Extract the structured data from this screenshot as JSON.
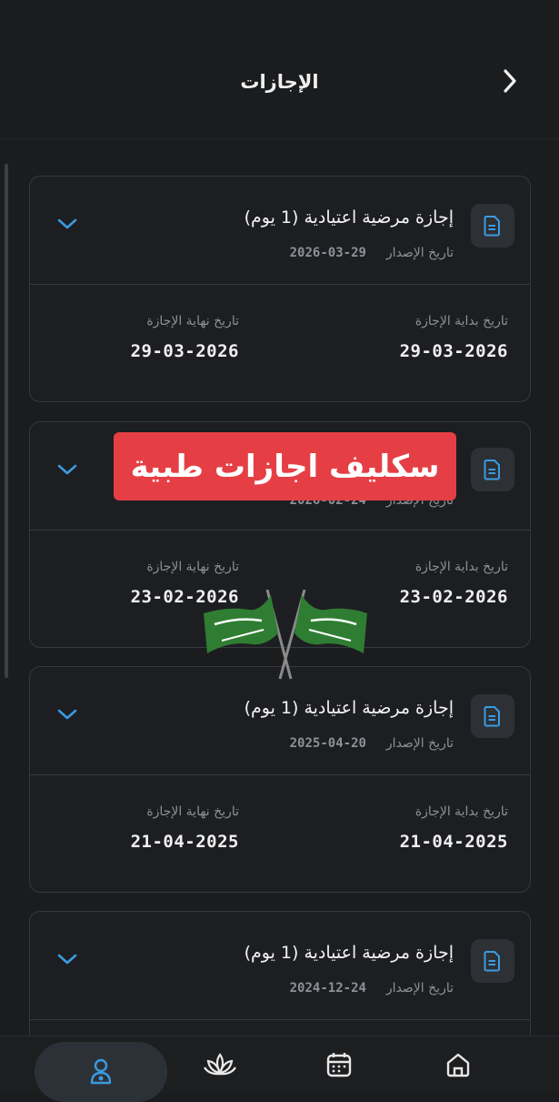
{
  "header": {
    "title": "الإجازات"
  },
  "leaves": [
    {
      "name": "إجازة مرضية اعتيادية (1 يوم)",
      "issue_label": "تاريخ الإصدار",
      "issue_date": "29-03-2026",
      "start_label": "تاريخ بداية الإجازة",
      "start_date": "29-03-2026",
      "end_label": "تاريخ نهاية الإجازة",
      "end_date": "29-03-2026"
    },
    {
      "name": "",
      "issue_label": "تاريخ الإصدار",
      "issue_date": "24-02-2026",
      "start_label": "تاريخ بداية الإجازة",
      "start_date": "23-02-2026",
      "end_label": "تاريخ نهاية الإجازة",
      "end_date": "23-02-2026"
    },
    {
      "name": "إجازة مرضية اعتيادية (1 يوم)",
      "issue_label": "تاريخ الإصدار",
      "issue_date": "20-04-2025",
      "start_label": "تاريخ بداية الإجازة",
      "start_date": "21-04-2025",
      "end_label": "تاريخ نهاية الإجازة",
      "end_date": "21-04-2025"
    },
    {
      "name": "إجازة مرضية اعتيادية (1 يوم)",
      "issue_label": "تاريخ الإصدار",
      "issue_date": "24-12-2024"
    }
  ],
  "overlay": {
    "banner_text": "سكليف اجازات طبية",
    "banner_color": "#e53f45"
  },
  "nav": [
    {
      "icon": "person-icon",
      "active": true
    },
    {
      "icon": "lotus-icon",
      "active": false
    },
    {
      "icon": "calendar-icon",
      "active": false
    },
    {
      "icon": "home-icon",
      "active": false
    }
  ],
  "colors": {
    "background": "#1b1c1e",
    "accent": "#3a9be0",
    "card_border": "#35383d"
  }
}
